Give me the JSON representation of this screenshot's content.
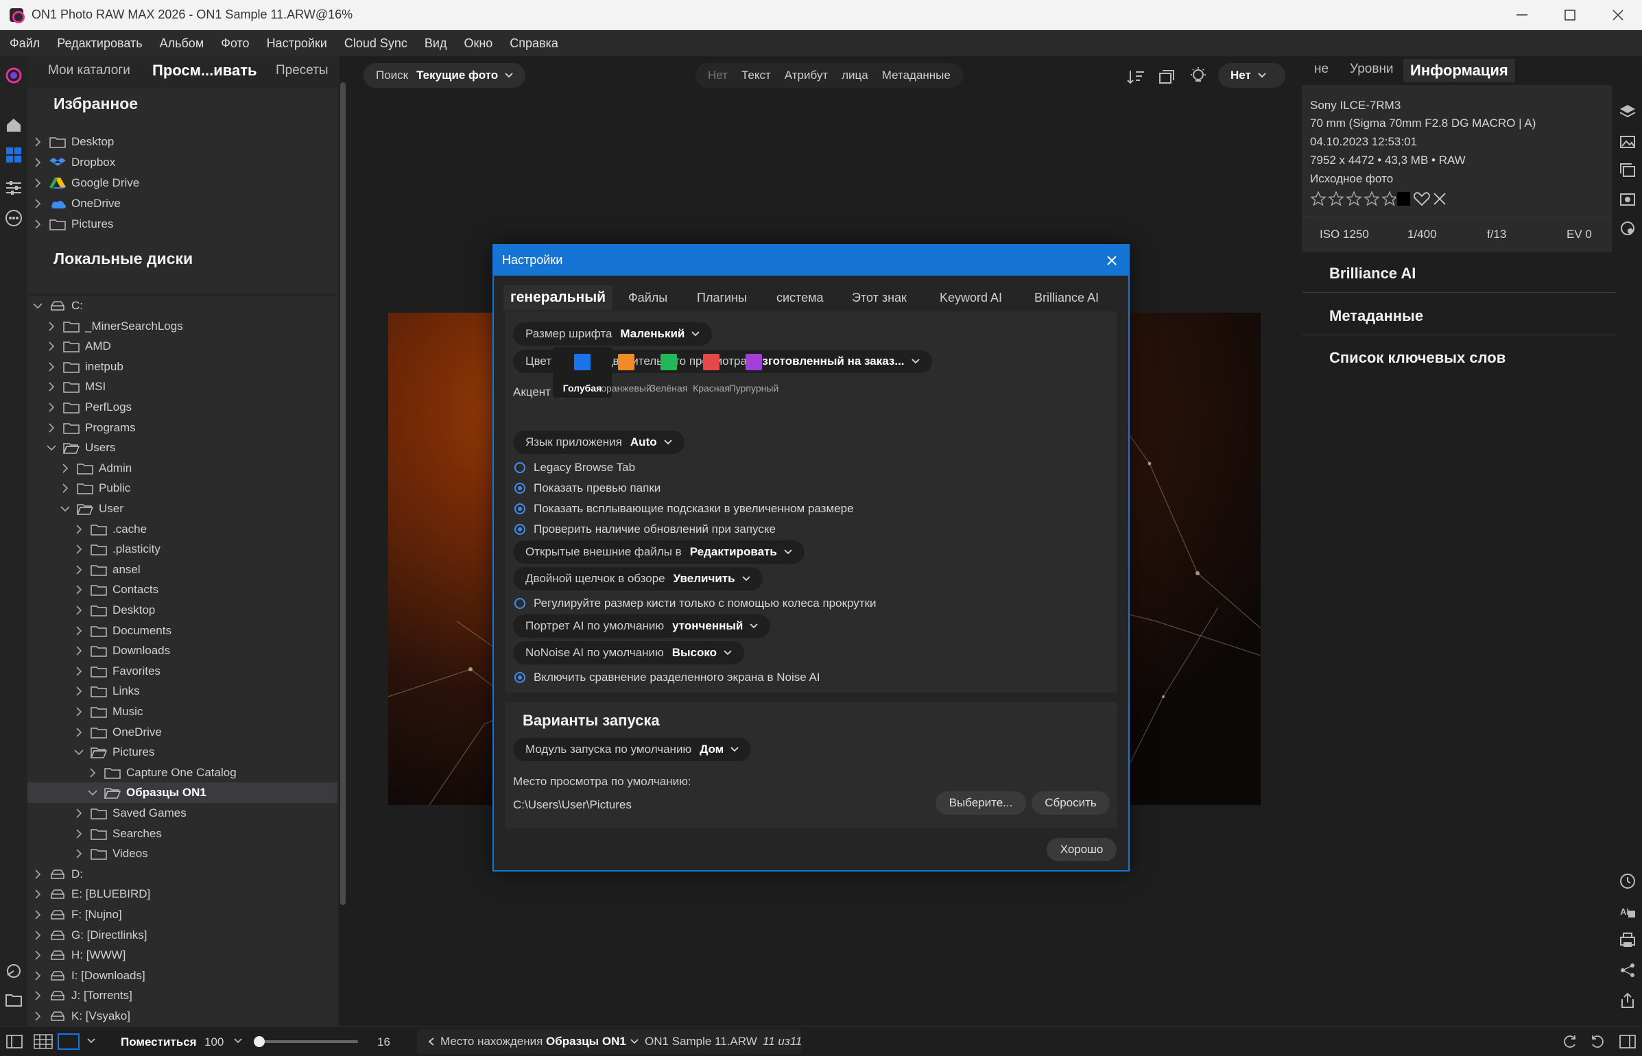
{
  "window": {
    "title": "ON1 Photo RAW MAX 2026 - ON1 Sample 11.ARW@16%"
  },
  "menu": [
    "Файл",
    "Редактировать",
    "Альбом",
    "Фото",
    "Настройки",
    "Cloud Sync",
    "Вид",
    "Окно",
    "Справка"
  ],
  "left_tabs": {
    "catalogs": "Мои каталоги",
    "browse": "Просм...ивать",
    "presets": "Пресеты"
  },
  "favorites": {
    "title": "Избранное",
    "items": [
      "Desktop",
      "Dropbox",
      "Google Drive",
      "OneDrive",
      "Pictures"
    ]
  },
  "local_disks": {
    "title": "Локальные диски",
    "rows": [
      {
        "label": "C:",
        "depth": 0,
        "open": true,
        "type": "drive"
      },
      {
        "label": "_MinerSearchLogs",
        "depth": 1,
        "open": false,
        "type": "folder"
      },
      {
        "label": "AMD",
        "depth": 1,
        "open": false,
        "type": "folder"
      },
      {
        "label": "inetpub",
        "depth": 1,
        "open": false,
        "type": "folder"
      },
      {
        "label": "MSI",
        "depth": 1,
        "open": false,
        "type": "folder"
      },
      {
        "label": "PerfLogs",
        "depth": 1,
        "open": false,
        "type": "folder"
      },
      {
        "label": "Programs",
        "depth": 1,
        "open": false,
        "type": "folder"
      },
      {
        "label": "Users",
        "depth": 1,
        "open": true,
        "type": "folder"
      },
      {
        "label": "Admin",
        "depth": 2,
        "open": false,
        "type": "folder"
      },
      {
        "label": "Public",
        "depth": 2,
        "open": false,
        "type": "folder"
      },
      {
        "label": "User",
        "depth": 2,
        "open": true,
        "type": "folder"
      },
      {
        "label": ".cache",
        "depth": 3,
        "open": false,
        "type": "folder"
      },
      {
        "label": ".plasticity",
        "depth": 3,
        "open": false,
        "type": "folder"
      },
      {
        "label": "ansel",
        "depth": 3,
        "open": false,
        "type": "folder"
      },
      {
        "label": "Contacts",
        "depth": 3,
        "open": false,
        "type": "folder"
      },
      {
        "label": "Desktop",
        "depth": 3,
        "open": false,
        "type": "folder"
      },
      {
        "label": "Documents",
        "depth": 3,
        "open": false,
        "type": "folder"
      },
      {
        "label": "Downloads",
        "depth": 3,
        "open": false,
        "type": "folder"
      },
      {
        "label": "Favorites",
        "depth": 3,
        "open": false,
        "type": "folder"
      },
      {
        "label": "Links",
        "depth": 3,
        "open": false,
        "type": "folder"
      },
      {
        "label": "Music",
        "depth": 3,
        "open": false,
        "type": "folder"
      },
      {
        "label": "OneDrive",
        "depth": 3,
        "open": false,
        "type": "folder"
      },
      {
        "label": "Pictures",
        "depth": 3,
        "open": true,
        "type": "folder"
      },
      {
        "label": "Capture One Catalog",
        "depth": 4,
        "open": false,
        "type": "folder"
      },
      {
        "label": "Образцы ON1",
        "depth": 4,
        "open": true,
        "type": "folder",
        "selected": true
      },
      {
        "label": "Saved Games",
        "depth": 3,
        "open": false,
        "type": "folder"
      },
      {
        "label": "Searches",
        "depth": 3,
        "open": false,
        "type": "folder"
      },
      {
        "label": "Videos",
        "depth": 3,
        "open": false,
        "type": "folder"
      },
      {
        "label": "D:",
        "depth": 0,
        "open": false,
        "type": "drive"
      },
      {
        "label": "E: [BLUEBIRD]",
        "depth": 0,
        "open": false,
        "type": "drive"
      },
      {
        "label": "F: [Nujno]",
        "depth": 0,
        "open": false,
        "type": "drive"
      },
      {
        "label": "G: [Directlinks]",
        "depth": 0,
        "open": false,
        "type": "drive"
      },
      {
        "label": "H: [WWW]",
        "depth": 0,
        "open": false,
        "type": "drive"
      },
      {
        "label": "I: [Downloads]",
        "depth": 0,
        "open": false,
        "type": "drive"
      },
      {
        "label": "J: [Torrents]",
        "depth": 0,
        "open": false,
        "type": "drive"
      },
      {
        "label": "K: [Vsyako]",
        "depth": 0,
        "open": false,
        "type": "drive"
      }
    ]
  },
  "center_toolbar": {
    "search_label": "Поиск",
    "search_value": "Текущие фото",
    "filters": [
      "Нет",
      "Текст",
      "Атрибут",
      "лица",
      "Метаданные"
    ],
    "sort_value": "Нет"
  },
  "right_tabs": {
    "ne": "не",
    "levels": "Уровни",
    "info": "Информация"
  },
  "info": {
    "camera": "Sony ILCE-7RM3",
    "lens": "70 mm (Sigma 70mm F2.8 DG MACRO | A)",
    "datetime": "04.10.2023 12:53:01",
    "dims": "7952 x 4472 • 43,3 MB • RAW",
    "source": "Исходное фото",
    "iso": "ISO 1250",
    "shutter": "1/400",
    "aperture": "f/13",
    "ev": "EV 0",
    "rating": 0
  },
  "right_sections": [
    "Brilliance AI",
    "Метаданные",
    "Список ключевых слов"
  ],
  "dialog": {
    "title": "Настройки",
    "tabs": [
      "генеральный",
      "Файлы",
      "Плагины",
      "система",
      "Этот знак",
      "Keyword AI",
      "Brilliance AI"
    ],
    "font_size_label": "Размер шрифта",
    "font_size_value": "Маленький",
    "preview_bg_label": "Цвет фона предварительного просмотра",
    "preview_bg_value": "изготовленный на заказ...",
    "accent_label": "Акцент Цвет",
    "accents": [
      {
        "name": "Голубая",
        "color": "#1a73e8",
        "selected": true
      },
      {
        "name": "оранжевый",
        "color": "#f28a25",
        "selected": false
      },
      {
        "name": "Зелёная",
        "color": "#22b85a",
        "selected": false
      },
      {
        "name": "Красная",
        "color": "#e54848",
        "selected": false
      },
      {
        "name": "Пурпурный",
        "color": "#a33fd9",
        "selected": false
      }
    ],
    "lang_label": "Язык приложения",
    "lang_value": "Auto",
    "opt_legacy": "Legacy Browse Tab",
    "opt_folder_previews": "Показать превью папки",
    "opt_tooltips": "Показать всплывающие подсказки в увеличенном размере",
    "opt_updates": "Проверить наличие обновлений при запуске",
    "open_external_label": "Открытые внешние файлы в",
    "open_external_value": "Редактировать",
    "dblclick_label": "Двойной щелчок в обзоре",
    "dblclick_value": "Увеличить",
    "opt_brush": "Регулируйте размер кисти только с помощью колеса прокрутки",
    "portrait_label": "Портрет AI по умолчанию",
    "portrait_value": "утонченный",
    "nonoise_label": "NoNoise AI по умолчанию",
    "nonoise_value": "Высоко",
    "opt_split": "Включить сравнение разделенного экрана в Noise AI",
    "launch_title": "Варианты запуска",
    "launch_module_label": "Модуль запуска по умолчанию",
    "launch_module_value": "Дом",
    "browse_location_label": "Место просмотра по умолчанию:",
    "browse_location_value": "C:\\Users\\User\\Pictures",
    "choose_btn": "Выберите...",
    "reset_btn": "Сбросить",
    "ok_btn": "Хорошо"
  },
  "bottom": {
    "fit_label": "Поместиться",
    "zoom_value": "100",
    "slider_value": "16",
    "location_label": "Место нахождения",
    "location_value": "Образцы ON1",
    "filename": "ON1 Sample 11.ARW",
    "counter": "11 из11"
  },
  "colors": {
    "accent": "#1574d4",
    "titlebar": "#f3f3f3",
    "panel": "#262626"
  }
}
